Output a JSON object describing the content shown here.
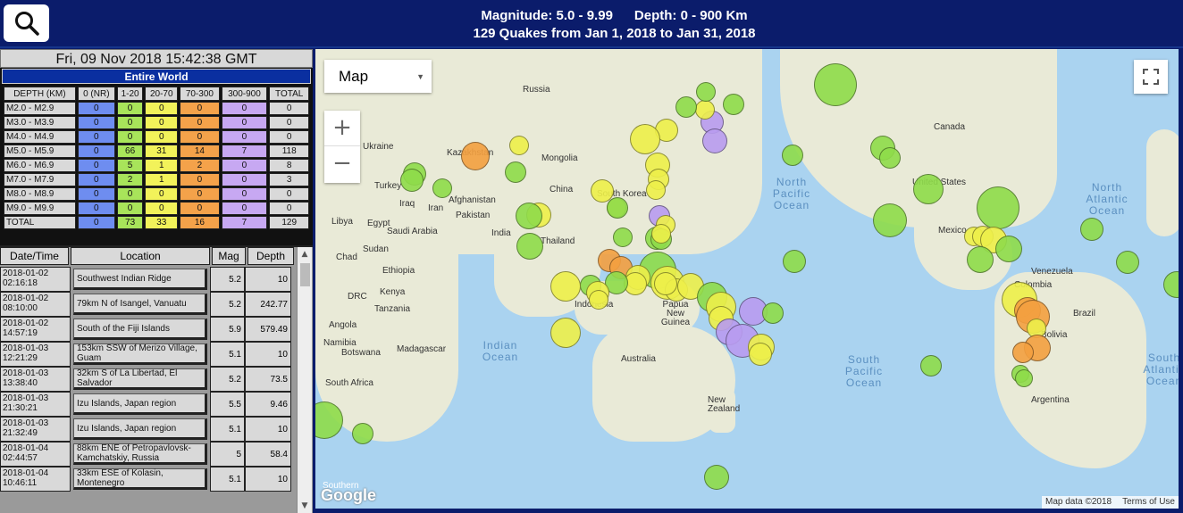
{
  "header": {
    "line1_mag": "Magnitude: 5.0 - 9.99",
    "line1_depth": "Depth: 0 - 900 Km",
    "line2": "129 Quakes from Jan 1, 2018 to Jan 31, 2018"
  },
  "left": {
    "datetime": "Fri, 09 Nov 2018 15:42:38 GMT",
    "region": "Entire World",
    "stats_headers": [
      "DEPTH (KM)",
      "0 (NR)",
      "1-20",
      "20-70",
      "70-300",
      "300-900",
      "TOTAL"
    ],
    "stats_rows": [
      {
        "label": "M2.0 - M2.9",
        "values": [
          "0",
          "0",
          "0",
          "0",
          "0",
          "0"
        ]
      },
      {
        "label": "M3.0 - M3.9",
        "values": [
          "0",
          "0",
          "0",
          "0",
          "0",
          "0"
        ]
      },
      {
        "label": "M4.0 - M4.9",
        "values": [
          "0",
          "0",
          "0",
          "0",
          "0",
          "0"
        ]
      },
      {
        "label": "M5.0 - M5.9",
        "values": [
          "0",
          "66",
          "31",
          "14",
          "7",
          "118"
        ]
      },
      {
        "label": "M6.0 - M6.9",
        "values": [
          "0",
          "5",
          "1",
          "2",
          "0",
          "8"
        ]
      },
      {
        "label": "M7.0 - M7.9",
        "values": [
          "0",
          "2",
          "1",
          "0",
          "0",
          "3"
        ]
      },
      {
        "label": "M8.0 - M8.9",
        "values": [
          "0",
          "0",
          "0",
          "0",
          "0",
          "0"
        ]
      },
      {
        "label": "M9.0 - M9.9",
        "values": [
          "0",
          "0",
          "0",
          "0",
          "0",
          "0"
        ]
      },
      {
        "label": "TOTAL",
        "values": [
          "0",
          "73",
          "33",
          "16",
          "7",
          "129"
        ]
      }
    ],
    "list_headers": {
      "date": "Date/Time",
      "location": "Location",
      "mag": "Mag",
      "depth": "Depth"
    },
    "quakes": [
      {
        "date": "2018-01-02",
        "time": "02:16:18",
        "location": "Southwest Indian Ridge",
        "mag": "5.2",
        "depth": "10"
      },
      {
        "date": "2018-01-02",
        "time": "08:10:00",
        "location": "79km N of Isangel, Vanuatu",
        "mag": "5.2",
        "depth": "242.77"
      },
      {
        "date": "2018-01-02",
        "time": "14:57:19",
        "location": "South of the Fiji Islands",
        "mag": "5.9",
        "depth": "579.49"
      },
      {
        "date": "2018-01-03",
        "time": "12:21:29",
        "location": "153km SSW of Merizo Village, Guam",
        "mag": "5.1",
        "depth": "10"
      },
      {
        "date": "2018-01-03",
        "time": "13:38:40",
        "location": "32km S of La Libertad, El Salvador",
        "mag": "5.2",
        "depth": "73.5"
      },
      {
        "date": "2018-01-03",
        "time": "21:30:21",
        "location": "Izu Islands, Japan region",
        "mag": "5.5",
        "depth": "9.46"
      },
      {
        "date": "2018-01-03",
        "time": "21:32:49",
        "location": "Izu Islands, Japan region",
        "mag": "5.1",
        "depth": "10"
      },
      {
        "date": "2018-01-04",
        "time": "02:44:57",
        "location": "88km ENE of Petropavlovsk-Kamchatskiy, Russia",
        "mag": "5",
        "depth": "58.4"
      },
      {
        "date": "2018-01-04",
        "time": "10:46:11",
        "location": "33km ESE of Kolasin, Montenegro",
        "mag": "5.1",
        "depth": "10"
      }
    ]
  },
  "map": {
    "type_label": "Map",
    "zoom_in": "+",
    "zoom_out": "−",
    "google": "Google",
    "attribution": "Map data ©2018",
    "terms": "Terms of Use",
    "labels": [
      "Russia",
      "Kazakhstan",
      "Mongolia",
      "China",
      "Ukraine",
      "Turkey",
      "Iraq",
      "Iran",
      "Afghanistan",
      "Pakistan",
      "India",
      "Libya",
      "Egypt",
      "Saudi Arabia",
      "Sudan",
      "Chad",
      "Ethiopia",
      "Kenya",
      "DRC",
      "Tanzania",
      "Angola",
      "Namibia",
      "Botswana",
      "Madagascar",
      "South Africa",
      "Thailand",
      "South Korea",
      "Indonesia",
      "Papua New Guinea",
      "Australia",
      "New Zealand",
      "Canada",
      "United States",
      "Mexico",
      "Venezuela",
      "Colombia",
      "Brazil",
      "Bolivia",
      "Argentina",
      "Southern"
    ],
    "oceans": [
      "North Pacific Ocean",
      "North Atlantic Ocean",
      "Indian Ocean",
      "South Pacific Ocean",
      "South Atlantic Ocean"
    ]
  }
}
